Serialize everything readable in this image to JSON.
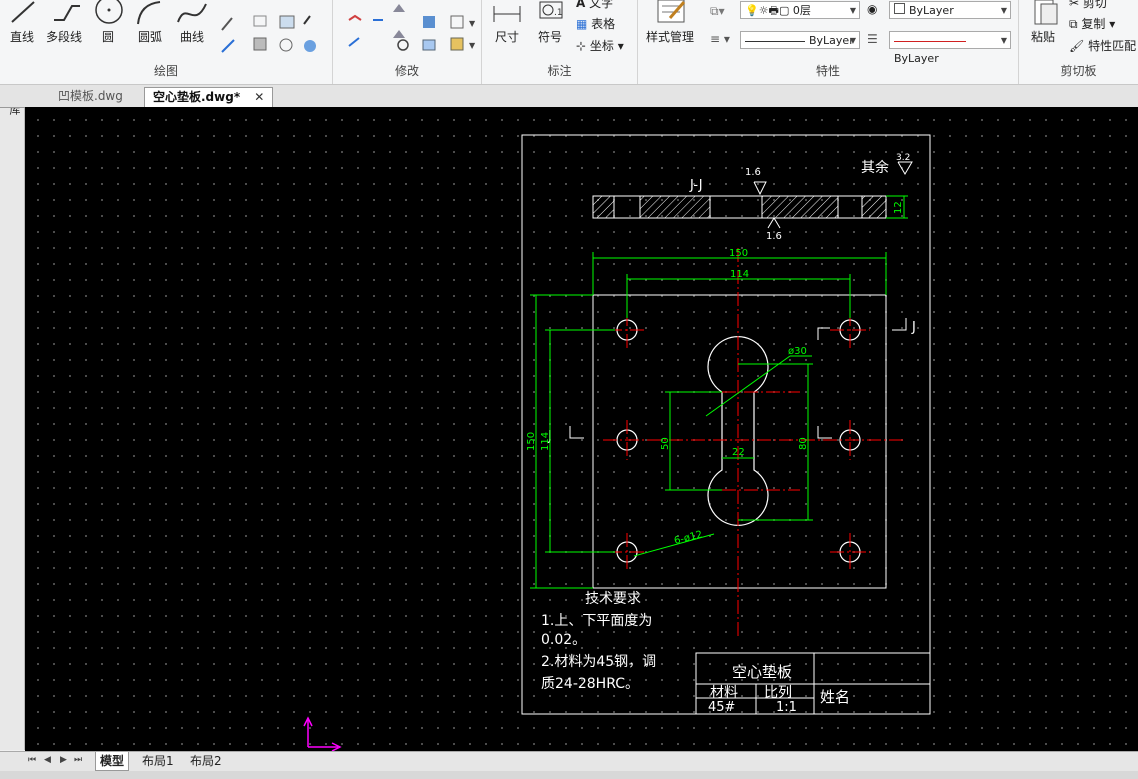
{
  "ribbon": {
    "draw": {
      "title": "绘图",
      "line": "直线",
      "polyline": "多段线",
      "circle": "圆",
      "arc": "圆弧",
      "curve": "曲线"
    },
    "modify": {
      "title": "修改"
    },
    "annotate": {
      "title": "标注",
      "dimension": "尺寸",
      "symbol": "符号",
      "text": "文字",
      "table": "表格",
      "coordinate": "坐标"
    },
    "properties": {
      "title": "特性",
      "style_manager": "样式管理",
      "layer": "0层",
      "color": "ByLayer",
      "linetype": "ByLayer",
      "lineweight": "ByLayer"
    },
    "clipboard": {
      "title": "剪切板",
      "paste": "粘贴",
      "cut": "剪切",
      "copy": "复制",
      "match": "特性匹配"
    }
  },
  "doc_tabs": [
    {
      "label": "凹模板.dwg",
      "active": false
    },
    {
      "label": "空心垫板.dwg*",
      "active": true
    }
  ],
  "side_palette": {
    "label": "图库"
  },
  "drawing": {
    "section_label": "J-J",
    "cut_marker": "J",
    "roughness_top": "1.6",
    "roughness_bottom": "1.6",
    "roughness_rest_label": "其余",
    "roughness_rest_value": "3.2",
    "thickness_dim": "12",
    "dim_150_h": "150",
    "dim_114_h": "114",
    "dim_150_v": "150",
    "dim_114_v": "114",
    "dim_phi30": "ø30",
    "dim_50": "50",
    "dim_80": "80",
    "dim_22": "22",
    "dim_holes": "6-ø12",
    "tech_title": "技术要求",
    "tech_line1": "1.上、下平面度为",
    "tech_line2": "0.02。",
    "tech_line3": "2.材料为45钢，调",
    "tech_line4": "质24-28HRC。",
    "tb_title": "空心垫板",
    "tb_material_label": "材料",
    "tb_scale_label": "比列",
    "tb_name_label": "姓名",
    "tb_material": "45#",
    "tb_scale": "1:1"
  },
  "layout_tabs": [
    "模型",
    "布局1",
    "布局2"
  ],
  "colors": {
    "canvas_bg": "#000000",
    "outline": "#ffffff",
    "dimension": "#00ff00",
    "centerline": "#ff0000",
    "ucs": "#ff00ff"
  }
}
